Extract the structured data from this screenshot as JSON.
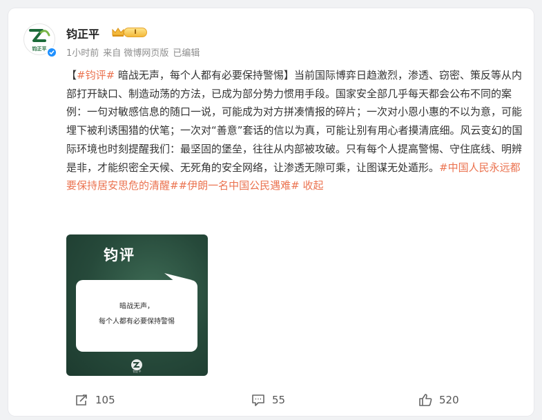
{
  "author": {
    "name": "钧正平",
    "level": "I",
    "avatar_text": "钧正平"
  },
  "meta": {
    "time": "1小时前",
    "source": "来自 微博网页版",
    "edited": "已编辑"
  },
  "post": {
    "open_bracket": "【",
    "topic_tag": "#钧评#",
    "headline": " 暗战无声，每个人都有必要保持警惕】",
    "body": "当前国际博弈日趋激烈，渗透、窃密、策反等从内部打开缺口、制造动荡的方法，已成为部分势力惯用手段。国家安全部几乎每天都会公布不同的案例：一句对敏感信息的随口一说，可能成为对方拼凑情报的碎片；一次对小恩小惠的不以为意，可能埋下被利诱围猎的伏笔；一次对“善意”套话的信以为真，可能让别有用心者摸清底细。风云变幻的国际环境也时刻提醒我们：最坚固的堡垒，往往从内部被攻破。只有每个人提高警惕、守住底线、明辨是非，才能织密全天候、无死角的安全网络，让渗透无隙可乘，让图谋无处遁形。",
    "hashtag_1": "#中国人民永远都要保持居安思危的清醒#",
    "hashtag_2": "#伊朗一名中国公民遇难#",
    "collapse_label": " 收起"
  },
  "image": {
    "title": "钧评",
    "line_1": "暗战无声，",
    "line_2": "每个人都有必要保持警惕",
    "logo_text": "钧正平"
  },
  "actions": {
    "repost_count": "105",
    "comment_count": "55",
    "like_count": "520"
  },
  "colors": {
    "accent": "#eb7350",
    "verified": "#1e90ff",
    "image_bg": "#26493a"
  }
}
